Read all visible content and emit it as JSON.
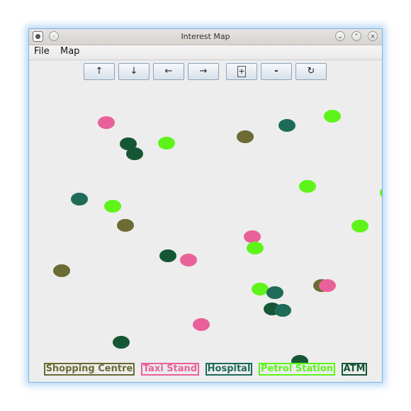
{
  "window": {
    "title": "Interest Map"
  },
  "menu": {
    "items": [
      "File",
      "Map"
    ]
  },
  "toolbar": {
    "up": "↑",
    "down": "↓",
    "left": "←",
    "right": "→",
    "zoom_in": "+",
    "zoom_out": "-",
    "refresh": "↻"
  },
  "legend": [
    {
      "label": "Shopping Centre",
      "color": "#6b6b33"
    },
    {
      "label": "Taxi Stand",
      "color": "#e9619a"
    },
    {
      "label": "Hospital",
      "color": "#1e6b58"
    },
    {
      "label": "Petrol Station",
      "color": "#5ef41a"
    },
    {
      "label": "ATM",
      "color": "#155735"
    }
  ],
  "colors": {
    "shopping": "#6b6b33",
    "taxi": "#e9619a",
    "hospital": "#1e6b58",
    "petrol": "#5ef41a",
    "atm": "#155735",
    "canvas_bg": "#ededed"
  }
}
